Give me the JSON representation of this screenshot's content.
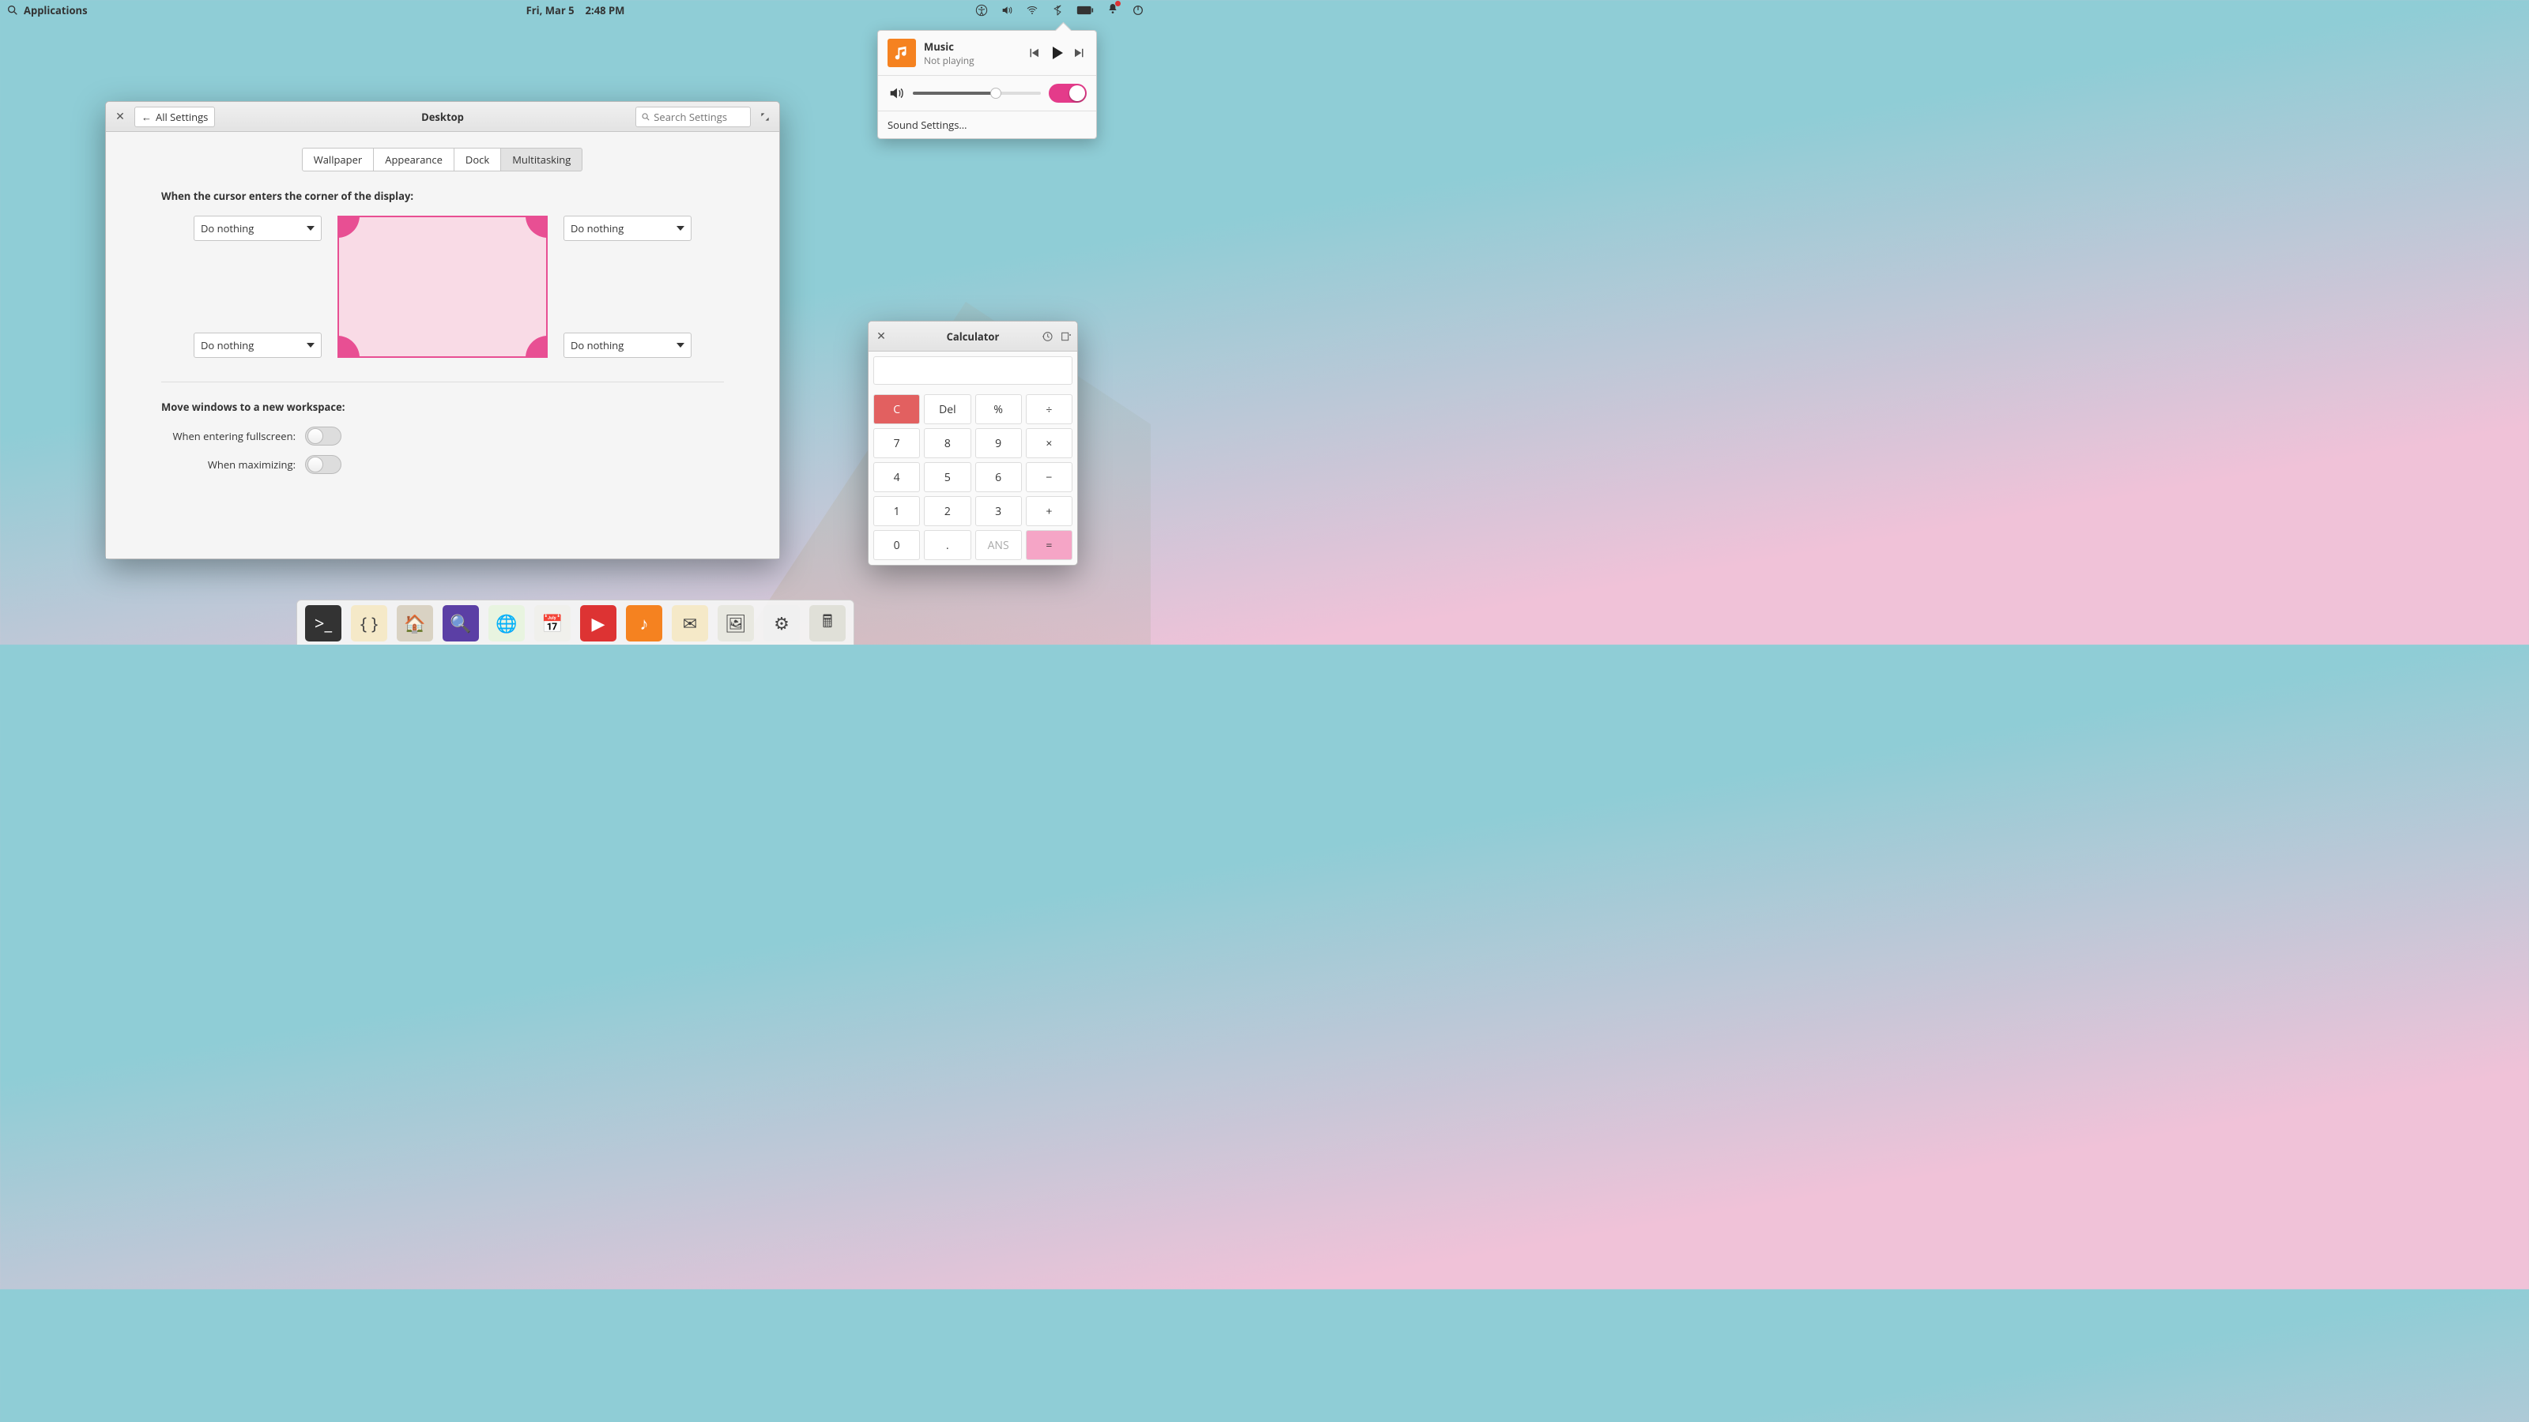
{
  "topbar": {
    "apps_label": "Applications",
    "date": "Fri, Mar 5",
    "time": "2:48 PM"
  },
  "sound_popover": {
    "title": "Music",
    "subtitle": "Not playing",
    "volume_percent": 65,
    "output_toggle_on": true,
    "settings_label": "Sound Settings…"
  },
  "settings_window": {
    "back_label": "All Settings",
    "title": "Desktop",
    "search_placeholder": "Search Settings",
    "tabs": [
      "Wallpaper",
      "Appearance",
      "Dock",
      "Multitasking"
    ],
    "active_tab_index": 3,
    "hot_corners": {
      "heading": "When the cursor enters the corner of the display:",
      "top_left": "Do nothing",
      "top_right": "Do nothing",
      "bottom_left": "Do nothing",
      "bottom_right": "Do nothing"
    },
    "move_windows": {
      "heading": "Move windows to a new workspace:",
      "fullscreen_label": "When entering fullscreen:",
      "fullscreen_on": false,
      "maximizing_label": "When maximizing:",
      "maximizing_on": false
    }
  },
  "calculator": {
    "title": "Calculator",
    "display": "",
    "keys": {
      "c": "C",
      "del": "Del",
      "pct": "%",
      "div": "÷",
      "k7": "7",
      "k8": "8",
      "k9": "9",
      "mul": "×",
      "k4": "4",
      "k5": "5",
      "k6": "6",
      "sub": "−",
      "k1": "1",
      "k2": "2",
      "k3": "3",
      "add": "+",
      "k0": "0",
      "dot": ".",
      "ans": "ANS",
      "eq": "="
    }
  },
  "dock": {
    "apps": [
      {
        "name": "terminal",
        "bg": "#333",
        "glyph": ">_"
      },
      {
        "name": "code",
        "bg": "#f5e9c8",
        "glyph": "{ }"
      },
      {
        "name": "files",
        "bg": "#d9d2c3",
        "glyph": "🏠"
      },
      {
        "name": "search-tool",
        "bg": "#5b3fa5",
        "glyph": "🔍"
      },
      {
        "name": "web-browser",
        "bg": "#e8f4e0",
        "glyph": "🌐"
      },
      {
        "name": "calendar",
        "bg": "#f0f0ec",
        "glyph": "📅"
      },
      {
        "name": "videos",
        "bg": "#d33",
        "glyph": "▶"
      },
      {
        "name": "music",
        "bg": "#f58220",
        "glyph": "♪"
      },
      {
        "name": "mail",
        "bg": "#f5e9c8",
        "glyph": "✉"
      },
      {
        "name": "photos",
        "bg": "#e8e8e0",
        "glyph": "🖼"
      },
      {
        "name": "tweaks",
        "bg": "#f0f0f0",
        "glyph": "⚙"
      },
      {
        "name": "calculator",
        "bg": "#e0e0d8",
        "glyph": "🖩"
      }
    ]
  }
}
